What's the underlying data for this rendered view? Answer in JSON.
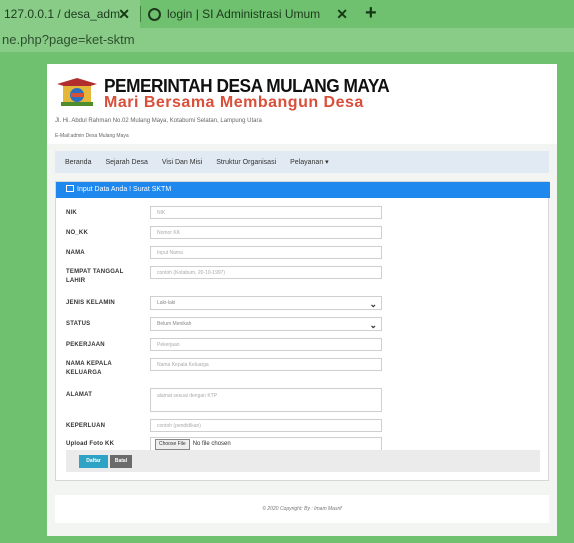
{
  "browser": {
    "tab1_title": "127.0.0.1 / desa_adm",
    "tab2_title": "login | SI Administrasi Umum",
    "url": "ne.php?page=ket-sktm"
  },
  "header": {
    "title": "PEMERINTAH DESA MULANG MAYA",
    "motto": "Mari Bersama Membangun Desa",
    "address": "Jl. Hi. Abdul Rahman No.02 Mulang Maya, Kotabumi Selatan, Lampung Utara",
    "email": "E-Mail:admin Desa Mulang Maya"
  },
  "nav": {
    "items": [
      "Beranda",
      "Sejarah Desa",
      "Visi Dan Misi",
      "Struktur Organisasi",
      "Pelayanan ▾"
    ]
  },
  "form": {
    "title": "Input Data Anda ! Surat SKTM",
    "fields": [
      {
        "label": "NIK",
        "placeholder": "NIK"
      },
      {
        "label": "NO_KK",
        "placeholder": "Nomor KK"
      },
      {
        "label": "NAMA",
        "placeholder": "Input Nama"
      },
      {
        "label": "TEMPAT TANGGAL LAHIR",
        "placeholder": "contoh (Kotabum, 20-10-1997)"
      },
      {
        "label": "JENIS KELAMIN",
        "value": "Laki-laki"
      },
      {
        "label": "STATUS",
        "value": "Belum Menikah"
      },
      {
        "label": "PEKERJAAN",
        "placeholder": "Pekerjaan"
      },
      {
        "label": "NAMA KEPALA KELUARGA",
        "placeholder": "Nama Kepala Keluarga"
      },
      {
        "label": "ALAMAT",
        "placeholder": "alamat sesuai dengan KTP"
      },
      {
        "label": "KEPERLUAN",
        "placeholder": "contoh (pendidikan)"
      },
      {
        "label": "Upload Foto KK",
        "button": "Choose File",
        "status": "No file chosen"
      }
    ],
    "submit_label": "Daftar",
    "cancel_label": "Batal"
  },
  "footer": {
    "text": "© 2020 Copyright: By : Imam Masrif"
  }
}
